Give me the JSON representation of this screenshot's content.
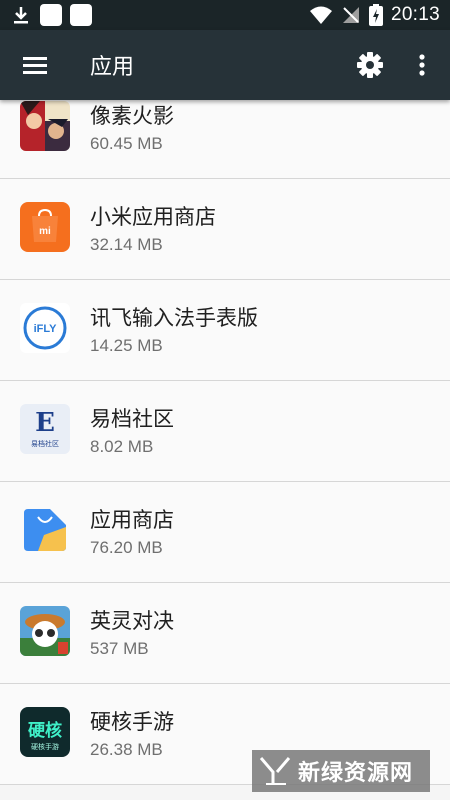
{
  "status_bar": {
    "time": "20:13"
  },
  "app_bar": {
    "title": "应用"
  },
  "apps": [
    {
      "name": "像素火影",
      "size": "60.45 MB"
    },
    {
      "name": "小米应用商店",
      "size": "32.14 MB"
    },
    {
      "name": "讯飞输入法手表版",
      "size": "14.25 MB"
    },
    {
      "name": "易档社区",
      "size": "8.02 MB"
    },
    {
      "name": "应用商店",
      "size": "76.20 MB"
    },
    {
      "name": "英灵对决",
      "size": "537 MB"
    },
    {
      "name": "硬核手游",
      "size": "26.38 MB"
    }
  ],
  "icon_text": {
    "mi": "mi",
    "ifly": "iFLY",
    "yidang": "易档社区",
    "yingke_big": "硬核",
    "yingke_small": "硬核手游"
  },
  "watermark": {
    "text": "新绿资源网"
  },
  "colors": {
    "status_bar": "#1b2528",
    "app_bar": "#263238",
    "list_bg": "#fafafa",
    "divider": "#d6d6d6"
  }
}
